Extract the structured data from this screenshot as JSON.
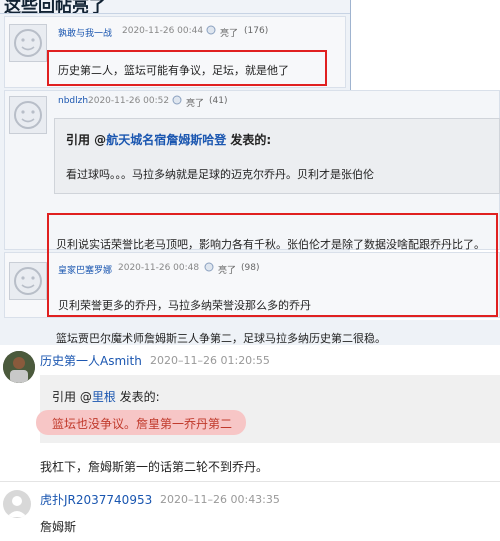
{
  "page": {
    "header_title": "这些回帖亮了"
  },
  "posts": [
    {
      "username": "孰敢与我一战",
      "timestamp": "2020-11-26 00:44",
      "like_label": "亮了",
      "like_count": "(176)",
      "body": "历史第二人，篮坛可能有争议，足坛，就是他了"
    },
    {
      "username": "nbdlzh",
      "timestamp": "2020-11-26 00:52",
      "like_label": "亮了",
      "like_count": "(41)",
      "quote_prefix": "引用 @",
      "quote_user": "航天城名宿詹姆斯哈登",
      "quote_suffix": " 发表的:",
      "quote_body": "看过球吗。。。马拉多纳就是足球的迈克尔乔丹。贝利才是张伯伦",
      "body": "贝利说实话荣誉比老马顶吧，影响力各有千秋。张伯伦才是除了数据没啥配跟乔丹比了。"
    },
    {
      "username": "皇家巴塞罗娜",
      "timestamp": "2020-11-26 00:48",
      "like_label": "亮了",
      "like_count": "(98)",
      "body": "贝利荣誉更多的乔丹，马拉多纳荣誉没那么多的乔丹"
    },
    {
      "body": "篮坛贾巴尔魔术师詹姆斯三人争第二，足球马拉多纳历史第二很稳。"
    },
    {
      "username": "历史第一人Asmith",
      "timestamp": "2020–11–26 01:20:55",
      "quote_prefix": "引用 @",
      "quote_user": "里根",
      "quote_suffix": " 发表的:",
      "quote_body": "篮坛也没争议。詹皇第一乔丹第二",
      "body": "我杠下，詹姆斯第一的话第二轮不到乔丹。"
    },
    {
      "username": "虎扑JR2037740953",
      "timestamp": "2020–11–26 00:43:35",
      "body": "詹姆斯"
    }
  ]
}
